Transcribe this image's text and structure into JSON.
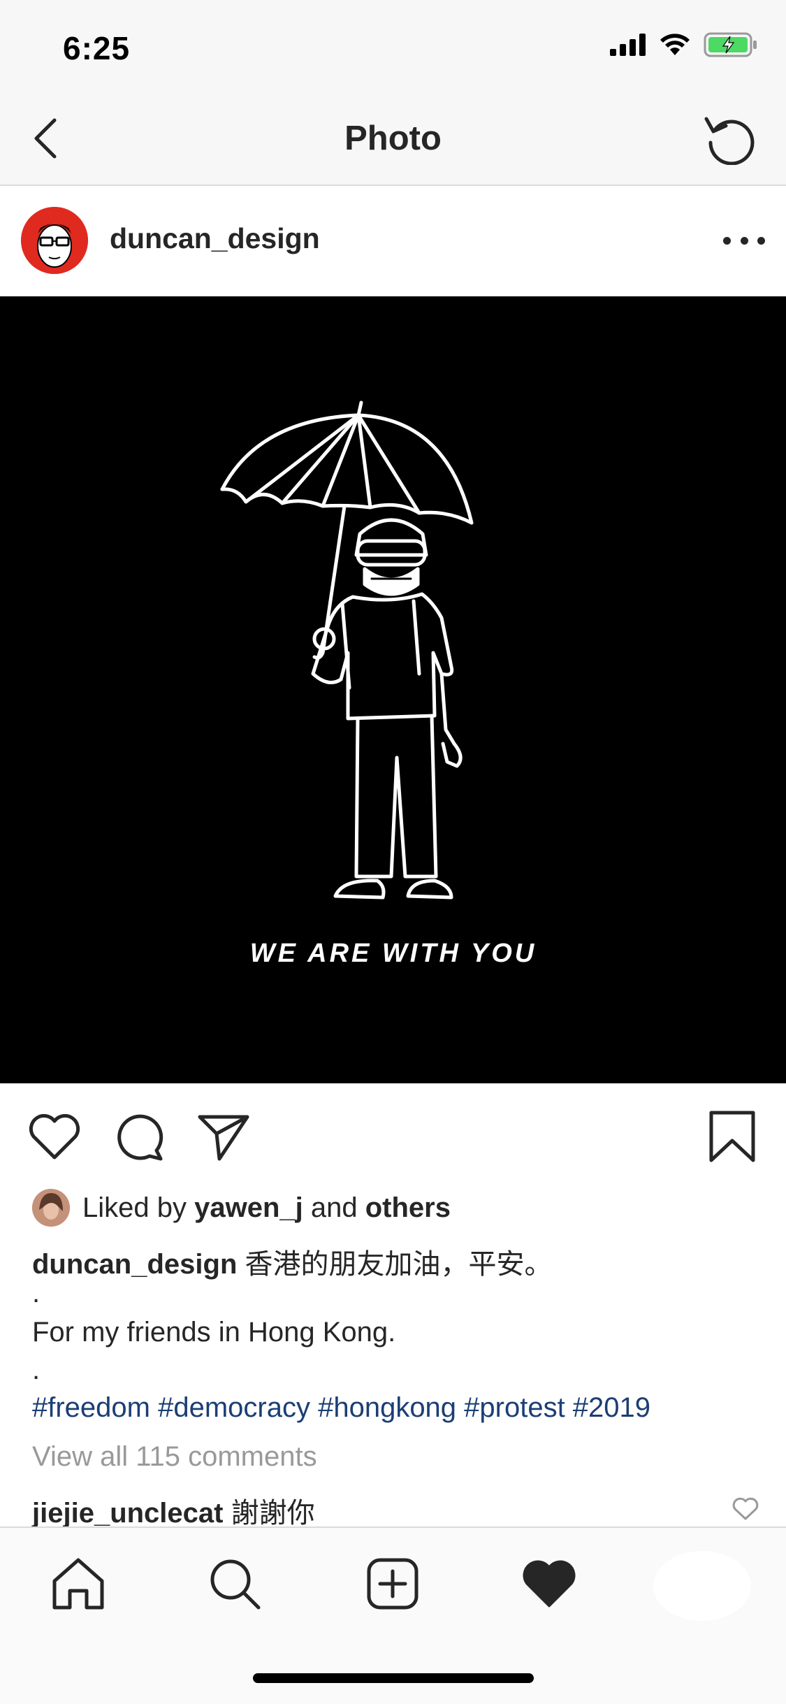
{
  "status_bar": {
    "time": "6:25",
    "icons": [
      "signal-icon",
      "wifi-icon",
      "battery-charging-icon"
    ]
  },
  "nav": {
    "title": "Photo",
    "back_icon": "chevron-left-icon",
    "refresh_icon": "refresh-icon"
  },
  "post": {
    "username": "duncan_design",
    "image_text": "WE ARE WITH YOU",
    "liked_by_prefix": "Liked by ",
    "liked_by_user": "yawen_j",
    "liked_by_and": " and ",
    "liked_by_others": "others",
    "caption_user": "duncan_design",
    "caption_text": " 香港的朋友加油，平安。",
    "caption_dot1": ".",
    "caption_line2": "For my friends in Hong Kong.",
    "caption_dot2": ".",
    "hashtags": "#freedom #democracy #hongkong #protest #2019",
    "view_all_comments": "View all 115 comments",
    "comment_user": "jiejie_unclecat",
    "comment_text": " 謝謝你"
  },
  "colors": {
    "accent_link": "#1b3e75",
    "avatar_bg": "#e02a1f",
    "battery": "#4cd964"
  },
  "tab_bar": {
    "icons": [
      "home-icon",
      "search-icon",
      "add-post-icon",
      "heart-filled-icon",
      "profile-icon"
    ]
  }
}
